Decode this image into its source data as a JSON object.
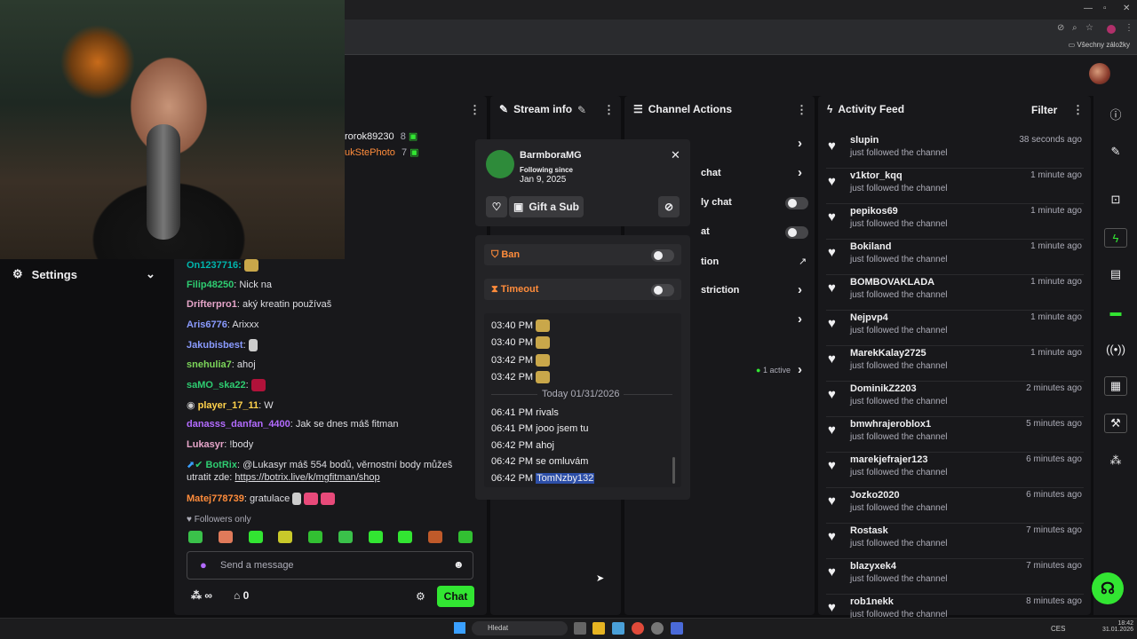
{
  "browser": {
    "bookmarks_label": "Všechny záložky"
  },
  "panels": {
    "stream_info": "Stream info",
    "channel_actions": "Channel Actions",
    "activity_feed": "Activity Feed",
    "filter": "Filter"
  },
  "settings": {
    "label": "Settings"
  },
  "top_users": [
    {
      "name": "rorok89230",
      "count": "8"
    },
    {
      "name": "ukStePhoto",
      "count": "7"
    }
  ],
  "chat": {
    "messages": [
      {
        "user": "On1237716:",
        "text": "",
        "color": "#00b5ad"
      },
      {
        "user": "Filip48250",
        "text": ": Nick na",
        "color": "#2ecc71"
      },
      {
        "user": "Drifterpro1",
        "text": ": aký kreatin používaš",
        "color": "#e6a5c9"
      },
      {
        "user": "Aris6776",
        "text": ": Arixxx",
        "color": "#8a9bff"
      },
      {
        "user": "Jakubisbest",
        "text": ":",
        "color": "#8a9bff"
      },
      {
        "user": "snehulia7",
        "text": ": ahoj",
        "color": "#7cd65a"
      },
      {
        "user": "saMO_ska22",
        "text": ":",
        "color": "#2ecc71"
      },
      {
        "user": "player_17_11",
        "text": ": W",
        "color": "#ffd24c"
      },
      {
        "user": "danasss_danfan_4400",
        "text": ": Jak se dnes máš fitman",
        "color": "#b36bff"
      },
      {
        "user": "Lukasyr",
        "text": ": !body",
        "color": "#e6a5c9"
      },
      {
        "user": "BotRix",
        "text": ": @Lukasyr máš 554 bodů, věrnostní body můžeš",
        "color": "#2ecc71"
      },
      {
        "user": "",
        "text": "utratit zde: ",
        "color": "#dedee3"
      },
      {
        "user": "Matej778739",
        "text": ": gratulace",
        "color": "#ff8c3b"
      }
    ],
    "botrix_link": "https://botrix.live/k/mgfitman/shop",
    "followers_only": "Followers only",
    "send_placeholder": "Send a message",
    "points": "∞",
    "store_count": "0",
    "chat_button": "Chat"
  },
  "popup": {
    "username": "BarmboraMG",
    "following_since_label": "Following since",
    "following_since_date": "Jan 9, 2025",
    "gift_sub": "Gift a Sub",
    "ban": "Ban",
    "timeout": "Timeout",
    "history": [
      {
        "time": "03:40 PM",
        "text": ""
      },
      {
        "time": "03:40 PM",
        "text": ""
      },
      {
        "time": "03:42 PM",
        "text": ""
      },
      {
        "time": "03:42 PM",
        "text": ""
      }
    ],
    "today_label": "Today 01/31/2026",
    "today_history": [
      {
        "time": "06:41 PM",
        "text": "rivals"
      },
      {
        "time": "06:41 PM",
        "text": "jooo jsem tu"
      },
      {
        "time": "06:42 PM",
        "text": "ahoj"
      },
      {
        "time": "06:42 PM",
        "text": "se omluvám"
      },
      {
        "time": "06:42 PM",
        "text": "TomNzby132"
      }
    ]
  },
  "channel_actions": {
    "rows": [
      {
        "label": ""
      },
      {
        "label": "chat"
      },
      {
        "label": "ly chat"
      },
      {
        "label": "at"
      },
      {
        "label": "tion"
      },
      {
        "label": "striction"
      },
      {
        "label": ""
      }
    ],
    "active": "1 active"
  },
  "feed": {
    "subtitle": "just followed the channel",
    "items": [
      {
        "name": "slupin",
        "time": "38 seconds ago"
      },
      {
        "name": "v1ktor_kqq",
        "time": "1 minute ago"
      },
      {
        "name": "pepikos69",
        "time": "1 minute ago"
      },
      {
        "name": "Bokiland",
        "time": "1 minute ago"
      },
      {
        "name": "BOMBOVAKLADA",
        "time": "1 minute ago"
      },
      {
        "name": "Nejpvp4",
        "time": "1 minute ago"
      },
      {
        "name": "MarekKalay2725",
        "time": "1 minute ago"
      },
      {
        "name": "DominikZ2203",
        "time": "2 minutes ago"
      },
      {
        "name": "bmwhrajeroblox1",
        "time": "5 minutes ago"
      },
      {
        "name": "marekjefrajer123",
        "time": "6 minutes ago"
      },
      {
        "name": "Jozko2020",
        "time": "6 minutes ago"
      },
      {
        "name": "Rostask",
        "time": "7 minutes ago"
      },
      {
        "name": "blazyxek4",
        "time": "7 minutes ago"
      },
      {
        "name": "rob1nekk",
        "time": "8 minutes ago"
      }
    ]
  },
  "taskbar": {
    "search": "Hledat",
    "lang": "CES",
    "time": "18:42",
    "date": "31.01.2026"
  },
  "colors": {
    "accent": "#32e532",
    "panel": "#18181b",
    "bg": "#0e0e10"
  }
}
